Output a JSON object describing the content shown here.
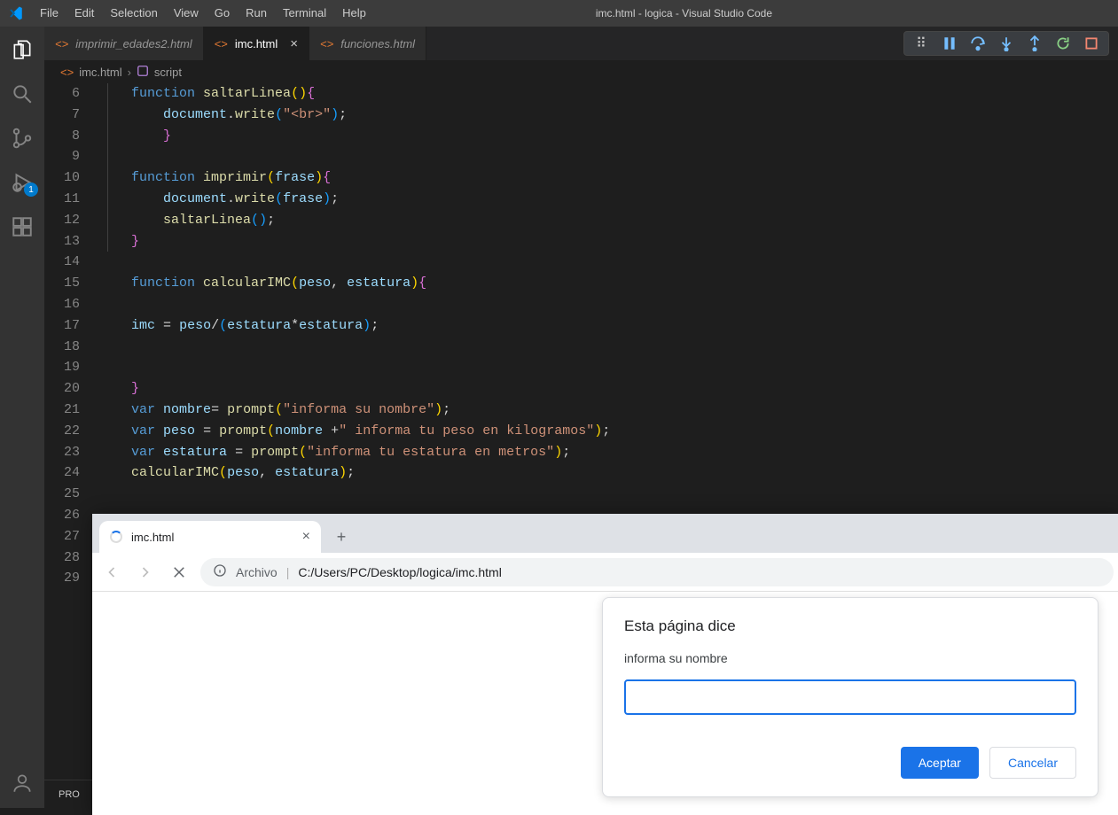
{
  "window_title": "imc.html - logica - Visual Studio Code",
  "menu": [
    "File",
    "Edit",
    "Selection",
    "View",
    "Go",
    "Run",
    "Terminal",
    "Help"
  ],
  "activity": {
    "debug_badge": "1"
  },
  "tabs": [
    {
      "label": "imprimir_edades2.html",
      "active": false
    },
    {
      "label": "imc.html",
      "active": true
    },
    {
      "label": "funciones.html",
      "active": false
    }
  ],
  "breadcrumb": {
    "file": "imc.html",
    "symbol": "script"
  },
  "gutter_start": 6,
  "gutter_end": 29,
  "code": {
    "l6": {
      "kw": "function",
      "fn": "saltarLinea"
    },
    "l7": {
      "obj": "document",
      "method": "write",
      "str": "\"<br>\""
    },
    "l10": {
      "kw": "function",
      "fn": "imprimir",
      "param": "frase"
    },
    "l11": {
      "obj": "document",
      "method": "write",
      "arg": "frase"
    },
    "l12": {
      "fn": "saltarLinea"
    },
    "l15": {
      "kw": "function",
      "fn": "calcularIMC",
      "p1": "peso",
      "p2": "estatura"
    },
    "l17": {
      "lhs": "imc",
      "p": "peso",
      "e1": "estatura",
      "e2": "estatura"
    },
    "l21": {
      "kw": "var",
      "name": "nombre",
      "fn": "prompt",
      "str": "\"informa su nombre\""
    },
    "l22": {
      "kw": "var",
      "name": "peso",
      "fn": "prompt",
      "arg": "nombre",
      "str": "\" informa tu peso en kilogramos\""
    },
    "l23": {
      "kw": "var",
      "name": "estatura",
      "fn": "prompt",
      "str": "\"informa tu estatura en metros\""
    },
    "l24": {
      "fn": "calcularIMC",
      "a1": "peso",
      "a2": "estatura"
    }
  },
  "panel_tab": "PRO",
  "browser": {
    "tab_title": "imc.html",
    "address_label": "Archivo",
    "address_path": "C:/Users/PC/Desktop/logica/imc.html",
    "dialog": {
      "title": "Esta página dice",
      "message": "informa su nombre",
      "input_value": "",
      "ok": "Aceptar",
      "cancel": "Cancelar"
    }
  }
}
